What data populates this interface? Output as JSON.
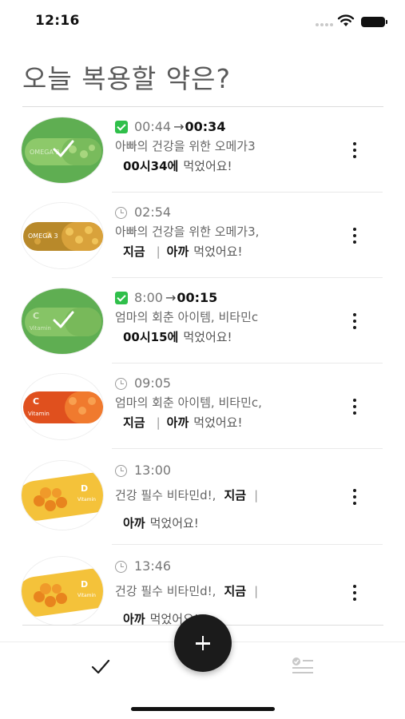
{
  "status_bar": {
    "time": "12:16"
  },
  "title": "오늘 복용할 약은?",
  "meds": [
    {
      "status": "done",
      "scheduled": "00:44",
      "arrow": "→",
      "taken_time": "00:34",
      "name": "아빠의 건강을 위한 오메가3",
      "taken_label": "00시34에",
      "taken_suffix": "먹었어요!",
      "thumb": "omega3-capsule-green"
    },
    {
      "status": "pending",
      "scheduled": "02:54",
      "name": "아빠의 건강을 위한 오메가3,",
      "now_label": "지금",
      "sep": "|",
      "earlier_label": "아까",
      "taken_suffix": "먹었어요!",
      "thumb": "omega3-capsule"
    },
    {
      "status": "done",
      "scheduled": "8:00",
      "arrow": "→",
      "taken_time": "00:15",
      "name": "엄마의 회춘 아이템, 비타민c",
      "taken_label": "00시15에",
      "taken_suffix": "먹었어요!",
      "thumb": "vitamin-c-capsule-green"
    },
    {
      "status": "pending",
      "scheduled": "09:05",
      "name": "엄마의 회춘 아이템, 비타민c,",
      "now_label": "지금",
      "sep": "|",
      "earlier_label": "아까",
      "taken_suffix": "먹었어요!",
      "thumb": "vitamin-c-capsule"
    },
    {
      "status": "pending",
      "scheduled": "13:00",
      "name": "건강 필수 비타민d!,",
      "now_label": "지금",
      "sep": "|",
      "earlier_label": "아까",
      "taken_suffix": "먹었어요!",
      "thumb": "vitamin-d-capsule"
    },
    {
      "status": "pending",
      "scheduled": "13:46",
      "name": "건강 필수 비타민d!,",
      "now_label": "지금",
      "sep": "|",
      "earlier_label": "아까",
      "taken_suffix": "먹었어요!",
      "thumb": "vitamin-d-capsule"
    }
  ],
  "thumb_text": {
    "omega": "OMEGA 3",
    "vitc_letter": "C",
    "vitc_word": "Vitamin",
    "vitd_letter": "D",
    "vitd_word": "Vitamin"
  },
  "icons": {
    "status_done": "check-square-icon",
    "status_pending": "clock-icon",
    "more": "more-vertical-icon",
    "fab": "plus-icon",
    "tab_today": "check-icon",
    "tab_list": "checklist-icon"
  },
  "colors": {
    "done_green": "#2fbf4a",
    "fab": "#1b1b1b",
    "title": "#5b5b5b"
  }
}
